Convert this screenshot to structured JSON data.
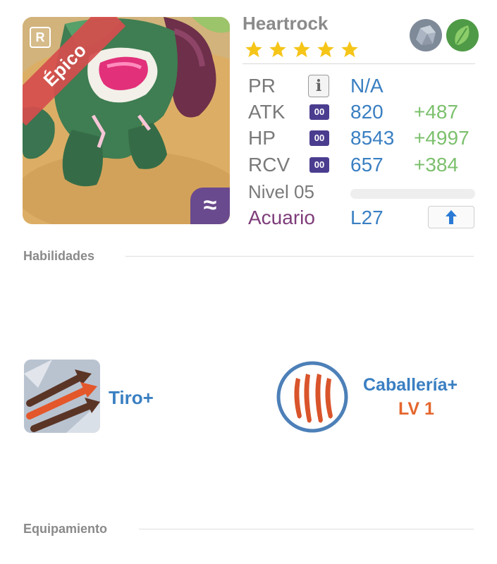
{
  "hero": {
    "name": "Heartrock",
    "stars": 5,
    "rank_badge": "R",
    "rarity": "Épico",
    "element_icon": "water-wave-icon",
    "types": [
      "stone-type-icon",
      "leaf-type-icon"
    ]
  },
  "stats": {
    "pr": {
      "label": "PR",
      "value": "N/A"
    },
    "atk": {
      "label": "ATK",
      "badge": "00",
      "value": "820",
      "bonus": "+487"
    },
    "hp": {
      "label": "HP",
      "badge": "00",
      "value": "8543",
      "bonus": "+4997"
    },
    "rcv": {
      "label": "RCV",
      "badge": "00",
      "value": "657",
      "bonus": "+384"
    },
    "level": {
      "label": "Nivel 05",
      "progress_percent": 0
    },
    "trait": {
      "label": "Acuario",
      "value": "L27"
    }
  },
  "sections": {
    "skills_title": "Habilidades",
    "equipment_title": "Equipamiento"
  },
  "skills": [
    {
      "name": "Tiro+",
      "icon": "arrows-icon"
    },
    {
      "name": "Caballería+",
      "level": "LV 1",
      "icon": "claw-marks-icon"
    }
  ],
  "colors": {
    "accent_blue": "#3a7fc2",
    "bonus_green": "#7cc06d",
    "trait_purple": "#7e3d7a",
    "level_orange": "#e4662d",
    "rarity_red": "#d64d4d"
  }
}
